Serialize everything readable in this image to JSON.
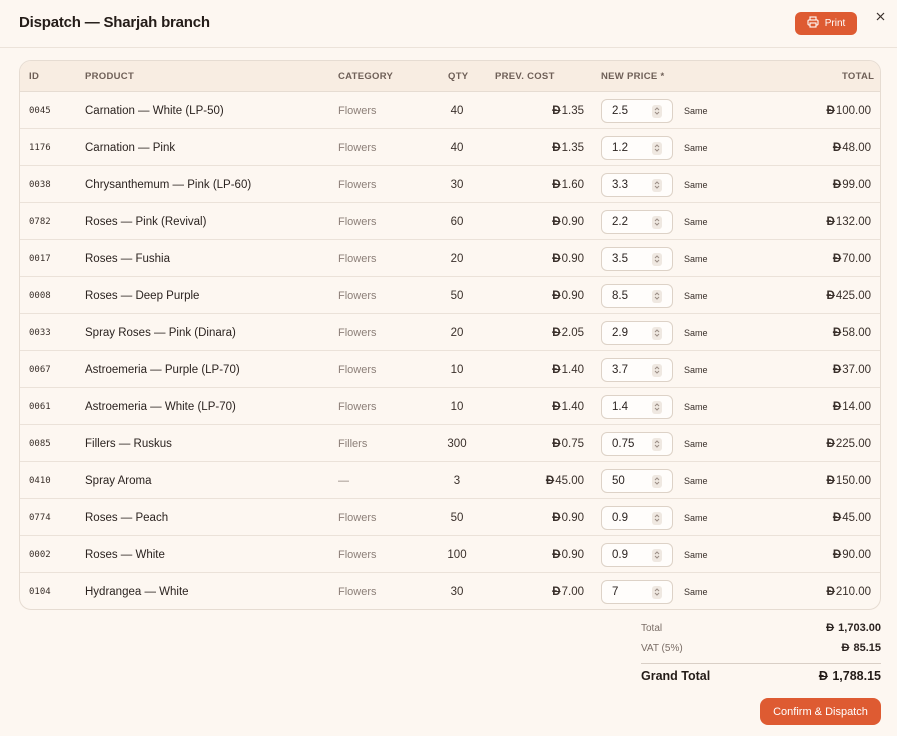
{
  "header": {
    "title": "Dispatch — Sharjah branch",
    "print_label": "Print"
  },
  "currency_symbol": "Đ",
  "table": {
    "columns": {
      "id": "ID",
      "product": "PRODUCT",
      "category": "CATEGORY",
      "qty": "QTY",
      "prev_cost": "PREV. COST",
      "new_price": "NEW PRICE *",
      "total": "TOTAL"
    },
    "rows": [
      {
        "id": "0045",
        "product": "Carnation — White (LP-50)",
        "category": "Flowers",
        "qty": "40",
        "prev_cost": "1.35",
        "new_price": "2.5",
        "change": "Same",
        "total": "100.00"
      },
      {
        "id": "1176",
        "product": "Carnation — Pink",
        "category": "Flowers",
        "qty": "40",
        "prev_cost": "1.35",
        "new_price": "1.2",
        "change": "Same",
        "total": "48.00"
      },
      {
        "id": "0038",
        "product": "Chrysanthemum — Pink (LP-60)",
        "category": "Flowers",
        "qty": "30",
        "prev_cost": "1.60",
        "new_price": "3.3",
        "change": "Same",
        "total": "99.00"
      },
      {
        "id": "0782",
        "product": "Roses — Pink (Revival)",
        "category": "Flowers",
        "qty": "60",
        "prev_cost": "0.90",
        "new_price": "2.2",
        "change": "Same",
        "total": "132.00"
      },
      {
        "id": "0017",
        "product": "Roses — Fushia",
        "category": "Flowers",
        "qty": "20",
        "prev_cost": "0.90",
        "new_price": "3.5",
        "change": "Same",
        "total": "70.00"
      },
      {
        "id": "0008",
        "product": "Roses — Deep Purple",
        "category": "Flowers",
        "qty": "50",
        "prev_cost": "0.90",
        "new_price": "8.5",
        "change": "Same",
        "total": "425.00"
      },
      {
        "id": "0033",
        "product": "Spray Roses — Pink (Dinara)",
        "category": "Flowers",
        "qty": "20",
        "prev_cost": "2.05",
        "new_price": "2.9",
        "change": "Same",
        "total": "58.00"
      },
      {
        "id": "0067",
        "product": "Astroemeria — Purple (LP-70)",
        "category": "Flowers",
        "qty": "10",
        "prev_cost": "1.40",
        "new_price": "3.7",
        "change": "Same",
        "total": "37.00"
      },
      {
        "id": "0061",
        "product": "Astroemeria — White (LP-70)",
        "category": "Flowers",
        "qty": "10",
        "prev_cost": "1.40",
        "new_price": "1.4",
        "change": "Same",
        "total": "14.00"
      },
      {
        "id": "0085",
        "product": "Fillers — Ruskus",
        "category": "Fillers",
        "qty": "300",
        "prev_cost": "0.75",
        "new_price": "0.75",
        "change": "Same",
        "total": "225.00"
      },
      {
        "id": "0410",
        "product": "Spray Aroma",
        "category": "—",
        "qty": "3",
        "prev_cost": "45.00",
        "new_price": "50",
        "change": "Same",
        "total": "150.00"
      },
      {
        "id": "0774",
        "product": "Roses — Peach",
        "category": "Flowers",
        "qty": "50",
        "prev_cost": "0.90",
        "new_price": "0.9",
        "change": "Same",
        "total": "45.00"
      },
      {
        "id": "0002",
        "product": "Roses — White",
        "category": "Flowers",
        "qty": "100",
        "prev_cost": "0.90",
        "new_price": "0.9",
        "change": "Same",
        "total": "90.00"
      },
      {
        "id": "0104",
        "product": "Hydrangea — White",
        "category": "Flowers",
        "qty": "30",
        "prev_cost": "7.00",
        "new_price": "7",
        "change": "Same",
        "total": "210.00"
      }
    ]
  },
  "summary": {
    "total_label": "Total",
    "total_value": "1,703.00",
    "vat_label": "VAT (5%)",
    "vat_value": "85.15",
    "grand_label": "Grand Total",
    "grand_value": "1,788.15"
  },
  "footer": {
    "confirm_label": "Confirm & Dispatch"
  },
  "colors": {
    "accent": "#de5b32",
    "background": "#fdf7f1",
    "header_row": "#f8ede2"
  }
}
